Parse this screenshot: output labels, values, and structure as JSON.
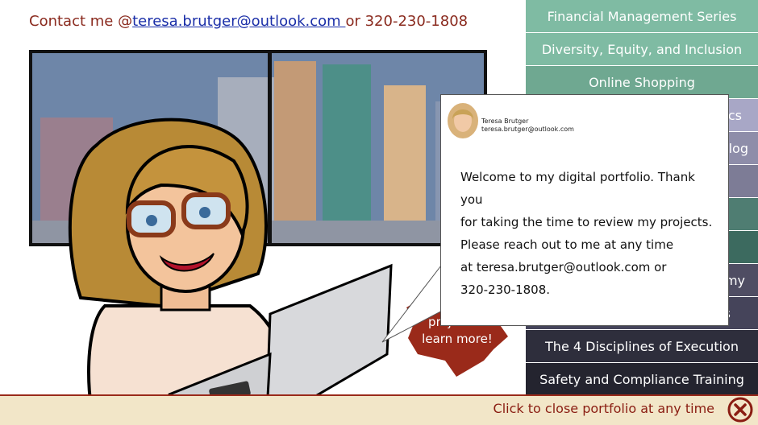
{
  "contact": {
    "prefix": "Contact me @",
    "email": "teresa.brutger@outlook.com ",
    "suffix": "or 320-230-1808"
  },
  "nav": {
    "items": [
      {
        "label": "Financial Management Series",
        "color": "#7fbba3"
      },
      {
        "label": "Diversity, Equity, and Inclusion",
        "color": "#7fbba3"
      },
      {
        "label": "Online Shopping",
        "color": "#6fa891"
      },
      {
        "label": "cs",
        "color": "#a8a7c6"
      },
      {
        "label": "log",
        "color": "#8e8da9"
      },
      {
        "label": "",
        "color": "#7d7c96"
      },
      {
        "label": "",
        "color": "#4f7d72"
      },
      {
        "label": "",
        "color": "#3c6a5f"
      },
      {
        "label": "my",
        "color": "#4f4d63"
      },
      {
        "label": "s",
        "color": "#45445a"
      },
      {
        "label": "The 4 Disciplines of Execution",
        "color": "#2e2e3c"
      },
      {
        "label": "Safety and Compliance Training",
        "color": "#24242f"
      }
    ]
  },
  "popup": {
    "name": "Teresa Brutger",
    "email": "teresa.brutger@outlook.com",
    "message_lines": [
      "Welcome to my digital portfolio.  Thank you",
      "for taking the time to review my projects.",
      "Please reach out to me at any time",
      "at teresa.brutger@outlook.com or",
      "320-230-1808."
    ]
  },
  "badge": {
    "line1": "project to",
    "line2": "learn more!"
  },
  "footer": {
    "close_text": "Click to close portfolio at any time"
  },
  "colors": {
    "accent_red": "#8a1d12",
    "badge": "#9a2a1a",
    "link_blue": "#1a2ea8"
  }
}
